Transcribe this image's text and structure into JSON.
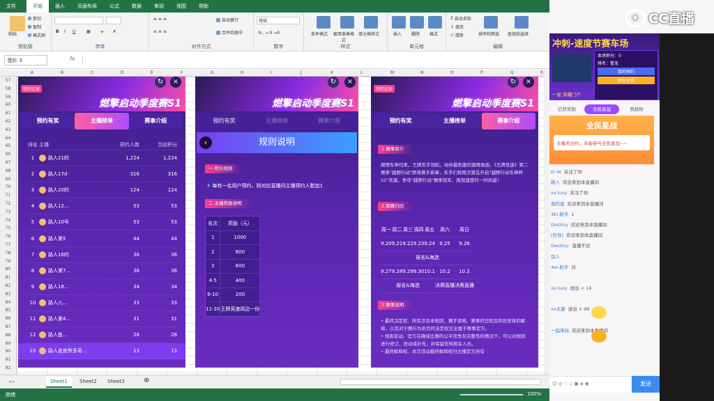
{
  "excel": {
    "tabs": [
      "文件",
      "开始",
      "插入",
      "页面布局",
      "公式",
      "数据",
      "审阅",
      "视图",
      "帮助"
    ],
    "ribbon": {
      "paste": "粘贴",
      "cut": "剪切",
      "copy": "复制",
      "format_painter": "格式刷",
      "wrap": "自动换行",
      "merge": "合并后居中",
      "number_format": "常规",
      "cond_fmt": "条件格式",
      "table_fmt": "套用表格格式",
      "cell_style": "单元格样式",
      "insert": "插入",
      "delete": "删除",
      "format": "格式",
      "autosum": "自动求和",
      "fill": "填充",
      "clear": "清除",
      "sort": "排序和筛选",
      "find": "查找和选择",
      "groups": [
        "剪贴板",
        "字体",
        "对齐方式",
        "数字",
        "样式",
        "单元格",
        "编辑"
      ]
    },
    "name_box": "图片 3",
    "fx": "fx",
    "col_headers": [
      "A",
      "B",
      "C",
      "D",
      "E",
      "F",
      "G",
      "H",
      "I",
      "J",
      "K",
      "L",
      "M",
      "N",
      "O",
      "P",
      "Q",
      "R"
    ],
    "row_headers": [
      "57",
      "58",
      "59",
      "60",
      "61",
      "62",
      "63",
      "64",
      "65",
      "66",
      "67",
      "68",
      "69",
      "70",
      "71",
      "72",
      "73",
      "74",
      "75",
      "76",
      "77",
      "78",
      "79",
      "80",
      "81",
      "82",
      "83",
      "84",
      "85",
      "86",
      "87",
      "88",
      "89",
      "90",
      "91",
      "92"
    ],
    "sheets": [
      "Sheet1",
      "Sheet2",
      "Sheet3"
    ],
    "status_left": "就绪",
    "zoom": "100%"
  },
  "panel_a": {
    "badge": "预约记录",
    "title": "燃擎启动季度赛S1",
    "tabs": [
      "预约有奖",
      "主播榜单",
      "赛事介绍"
    ],
    "headers": [
      "排名",
      "主播",
      "预约人数",
      "当前积分"
    ],
    "rows": [
      {
        "rank": "1",
        "name": "路人21的",
        "booked": "1,224",
        "points": "1,224"
      },
      {
        "rank": "2",
        "name": "路人17d",
        "booked": "316",
        "points": "316"
      },
      {
        "rank": "3",
        "name": "路人20的",
        "booked": "124",
        "points": "124"
      },
      {
        "rank": "4",
        "name": "路人12...",
        "booked": "53",
        "points": "53"
      },
      {
        "rank": "5",
        "name": "路人10号",
        "booked": "53",
        "points": "53"
      },
      {
        "rank": "6",
        "name": "路人第5",
        "booked": "44",
        "points": "44"
      },
      {
        "rank": "7",
        "name": "路人16的",
        "booked": "36",
        "points": "36"
      },
      {
        "rank": "8",
        "name": "路人第7...",
        "booked": "36",
        "points": "36"
      },
      {
        "rank": "9",
        "name": "路人18...",
        "booked": "34",
        "points": "34"
      },
      {
        "rank": "10",
        "name": "路人八...",
        "booked": "33",
        "points": "33"
      },
      {
        "rank": "11",
        "name": "路人第4...",
        "booked": "31",
        "points": "31"
      },
      {
        "rank": "12",
        "name": "路人鱼...",
        "booked": "28",
        "points": "28"
      },
      {
        "rank": "19",
        "name": "路人皮皮熊多奇...",
        "booked": "13",
        "points": "13"
      }
    ]
  },
  "panel_b": {
    "title": "燃擎启动季度赛S1",
    "tabs": [
      "预约有奖",
      "主播榜单",
      "赛事介绍"
    ],
    "rules_title": "规则说明",
    "s1": "一.积分规则",
    "s1_text": "每有一名用户预约，则对应直播间主播预约人数加1",
    "s2": "二.主播奖励说明",
    "award_headers": [
      "名次",
      "奖励（元）"
    ],
    "awards": [
      [
        "1",
        "1000"
      ],
      [
        "2",
        "800"
      ],
      [
        "3",
        "600"
      ],
      [
        "4-5",
        "400"
      ],
      [
        "6-10",
        "200"
      ],
      [
        "11-20",
        "王牌竞速周边一份"
      ]
    ]
  },
  "panel_c": {
    "badge": "预约记录",
    "title": "燃擎启动季度赛S1",
    "tabs": [
      "预约有奖",
      "主播榜单",
      "赛事介绍"
    ],
    "s1": "1.赛事简介",
    "s1_text": "燃情车神归来，王牌车手领航，给你最刺激的激情角逐。《王牌竞速》第二赛季\"越野行动\"即将携手新章，车手们将再次聚在开启\"越野行动车神杯S2\"竞速，争夺\"越野行动\"赛季冠军，再现速度的一时风姿！",
    "s2": "2.观赛日历",
    "cal_head": [
      "周一",
      "周二",
      "周三",
      "周四",
      "周五",
      "周六",
      "周日"
    ],
    "cal_row1": [
      "9.20",
      "9.21",
      "9.22",
      "9.23",
      "9.24",
      "9.25",
      "9.26"
    ],
    "cal_note1": "报名&海选",
    "cal_row2": [
      "9.27",
      "9.28",
      "9.29",
      "9.30",
      "10.1",
      "10.2",
      "10.3"
    ],
    "cal_note2": "报名&海选",
    "cal_final": "决赛直播",
    "s3": "3.赛事说明",
    "s3_text": "• 最终决定权、所有涉及本规则、赛手资格、赛事的日程及阶段安排的解释，以及对于赛行为处罚的决定权交全属于赛事官方。\n• 规则变动、官方在确保比赛的公平竞争及完整性的情况下，可以对规则进行修订、改动或补充，并保留告知相关人员。\n• 最终解释权、本次活动最终解释权归主播官方所有"
  },
  "live": {
    "logo": "CC直播",
    "promo_title": "冲刺-速度节赛车场",
    "promo_rank": "本场积分：0",
    "promo_name": "排名：暂无",
    "promo_btn1": "我的预约",
    "promo_btn2": "积分兑奖",
    "promo_footer": "一星·荣耀门户",
    "tabs": [
      "已获奖励",
      "全民星战",
      "贡献榜"
    ],
    "quanmin": "全民星战",
    "quanmin_sub": "主播未达约，未能参与全民星战~~",
    "chat": [
      {
        "user": "Er.W",
        "text": "关注了你"
      },
      {
        "user": "路人",
        "text": "欢迎来到本直播间"
      },
      {
        "user": "xx.luxy",
        "text": "关注了你"
      },
      {
        "user": "我的宝",
        "text": "欢迎来到本直播间"
      },
      {
        "user": "4Er.射手",
        "text": "1"
      },
      {
        "user": "Destiny",
        "text": "欢迎来到本直播间"
      },
      {
        "user": "[任性]",
        "text": "欢迎来到本直播间"
      },
      {
        "user": "Destiny:",
        "text": "直播不达"
      },
      {
        "user": "别人",
        "text": ""
      },
      {
        "user": "4er.射手",
        "text": "对"
      },
      {
        "user": "",
        "text": ""
      },
      {
        "user": "xx.luxy",
        "text": "送出 × 14"
      },
      {
        "user": "",
        "text": ""
      },
      {
        "user": "xx太豪",
        "text": "送出 × 99"
      },
      {
        "user": "",
        "text": ""
      },
      {
        "user": "一起来玩",
        "text": "欢迎来到本直播间"
      }
    ],
    "gift1_count": "× 14",
    "gift2_count": "× 99",
    "input_placeholder": "",
    "send": "发送"
  }
}
